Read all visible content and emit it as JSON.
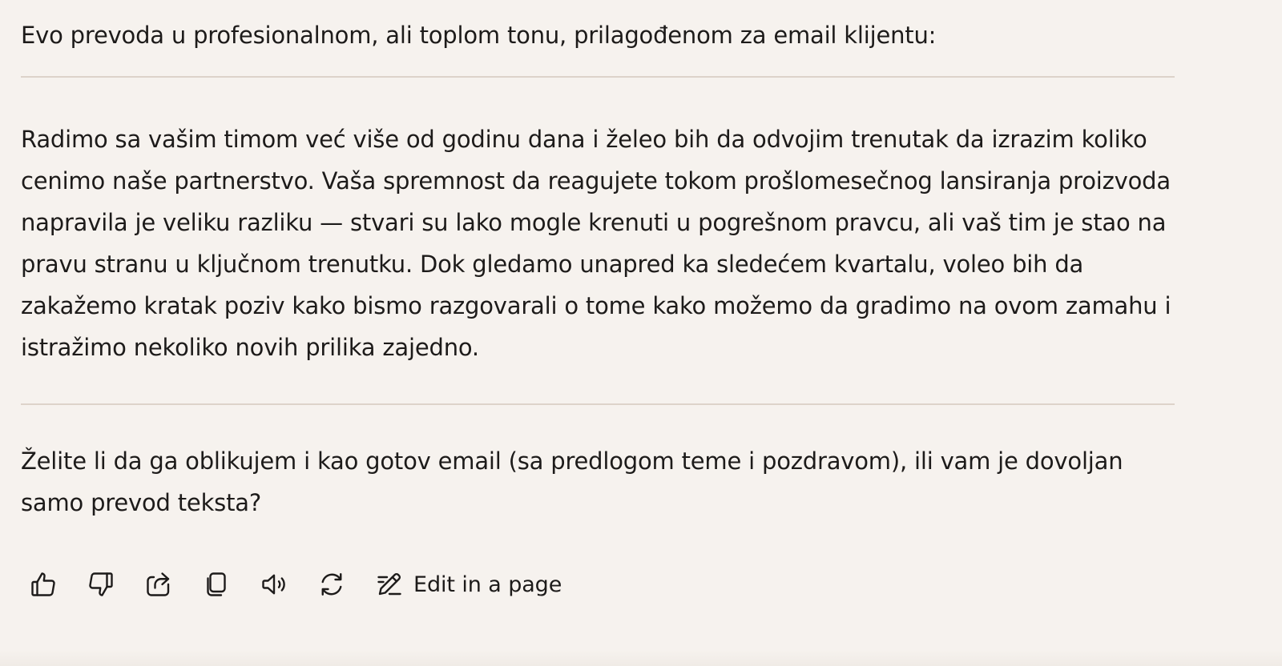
{
  "message": {
    "intro": "Evo prevoda u profesionalnom, ali toplom tonu, prilagođenom za email klijentu:",
    "body": "Radimo sa vašim timom već više od godinu dana i želeo bih da odvojim trenutak da izrazim koliko cenimo naše partnerstvo. Vaša spremnost da reagujete tokom prošlomesečnog lansiranja proizvoda napravila je veliku razliku — stvari su lako mogle krenuti u pogrešnom pravcu, ali vaš tim je stao na pravu stranu u ključnom trenutku. Dok gledamo unapred ka sledećem kvartalu, voleo bih da zakažemo kratak poziv kako bismo razgovarali o tome kako možemo da gradimo na ovom zamahu i istražimo nekoliko novih prilika zajedno.",
    "question": "Želite li da ga oblikujem i kao gotov email (sa predlogom teme i pozdravom), ili vam je dovoljan samo prevod teksta?"
  },
  "toolbar": {
    "edit_label": "Edit in a page",
    "icons": [
      "thumbs-up-icon",
      "thumbs-down-icon",
      "share-icon",
      "copy-icon",
      "speaker-icon",
      "regenerate-icon",
      "edit-pen-icon"
    ]
  }
}
